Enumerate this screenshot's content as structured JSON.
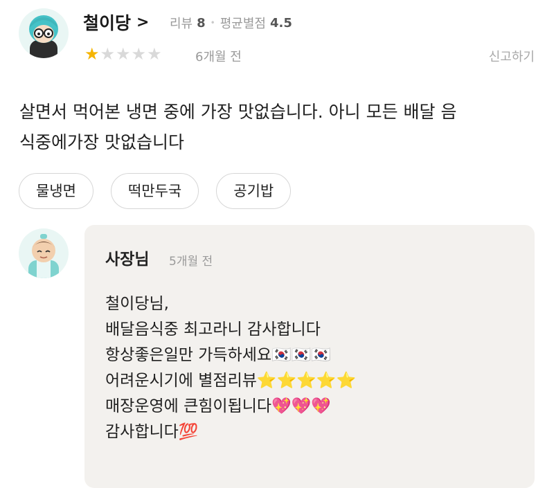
{
  "review": {
    "nickname": "철이당",
    "chevron": ">",
    "review_label": "리뷰",
    "review_count": "8",
    "separator": "•",
    "avg_label": "평균별점",
    "avg_rating": "4.5",
    "rating": 1,
    "max_rating": 5,
    "time": "6개월 전",
    "report_label": "신고하기",
    "text": "살면서 먹어본 냉면 중에 가장 맛없습니다. 아니 모든 배달 음\n식중에가장 맛없습니다",
    "menu_tags": [
      "물냉면",
      "떡만두국",
      "공기밥"
    ]
  },
  "owner_reply": {
    "name": "사장님",
    "time": "5개월 전",
    "text": "철이당님,\n배달음식중  최고라니 감사합니다\n항상좋은일만 가득하세요🇰🇷🇰🇷🇰🇷\n어려운시기에 별점리뷰⭐⭐⭐⭐⭐\n매장운영에 큰힘이됩니다💖💖💖\n감사합니다💯"
  },
  "colors": {
    "star_on": "#f5b400",
    "star_off": "#d9d9d9",
    "reply_bg": "#f3f1ee",
    "avatar_hair": "#45c2c7"
  }
}
